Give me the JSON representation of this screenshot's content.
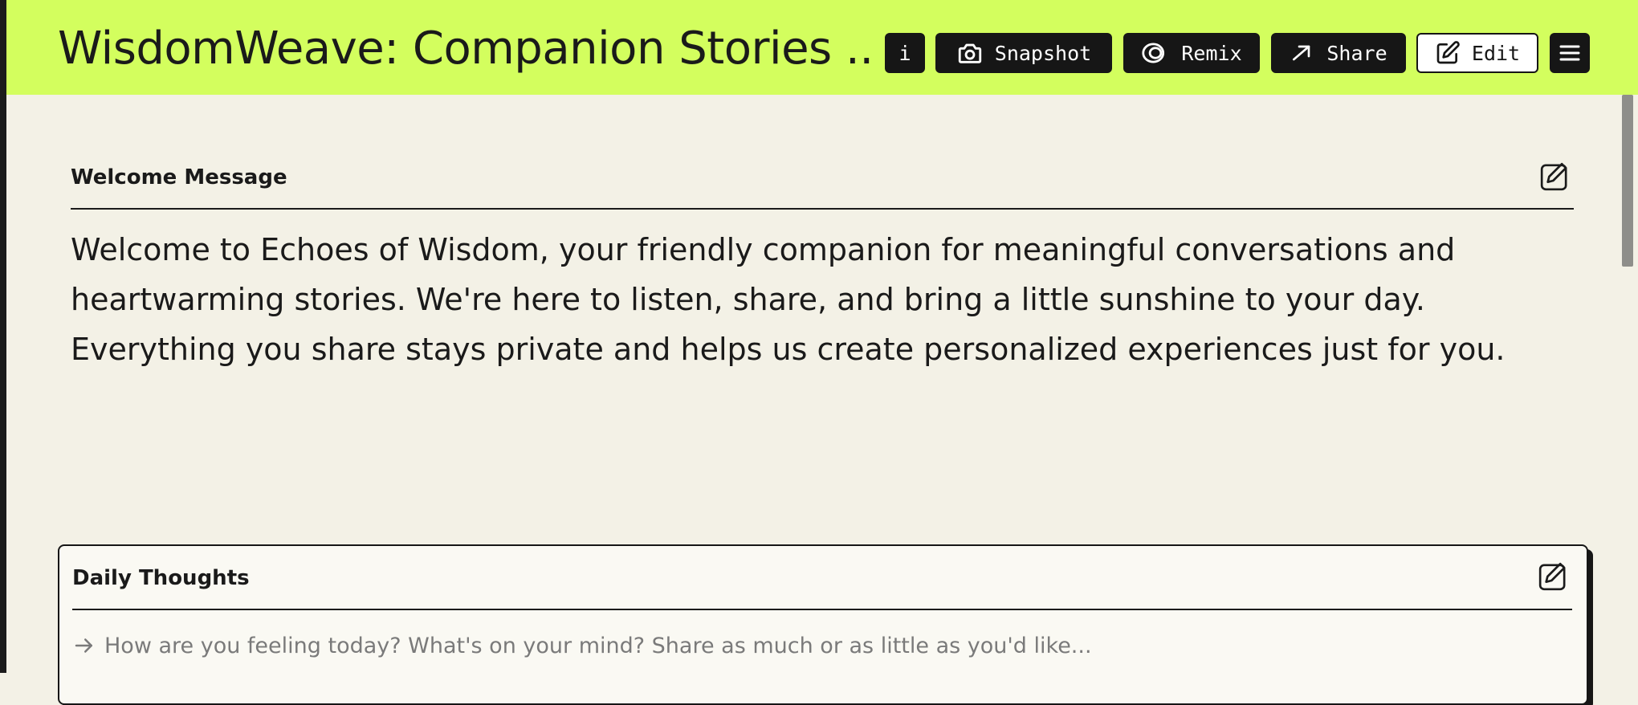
{
  "app": {
    "title": "WisdomWeave: Companion Stories ..."
  },
  "toolbar": {
    "info_label": "i",
    "snapshot_label": "Snapshot",
    "remix_label": "Remix",
    "share_label": "Share",
    "edit_label": "Edit"
  },
  "welcome": {
    "heading": "Welcome Message",
    "body": "Welcome to Echoes of Wisdom, your friendly companion for meaningful conversations and heartwarming stories. We're here to listen, share, and bring a little sunshine to your day. Everything you share stays private and helps us create personalized experiences just for you."
  },
  "daily": {
    "heading": "Daily Thoughts",
    "placeholder": "How are you feeling today? What's on your mind? Share as much or as little as you'd like..."
  },
  "colors": {
    "topbar": "#d3fe5e",
    "page_background": "#f3f1e6",
    "button_dark": "#161616"
  },
  "icons": {
    "snapshot": "camera-icon",
    "remix": "remix-icon",
    "share": "arrow-right-icon",
    "edit": "pencil-square-icon",
    "menu": "hamburger-menu-icon"
  }
}
